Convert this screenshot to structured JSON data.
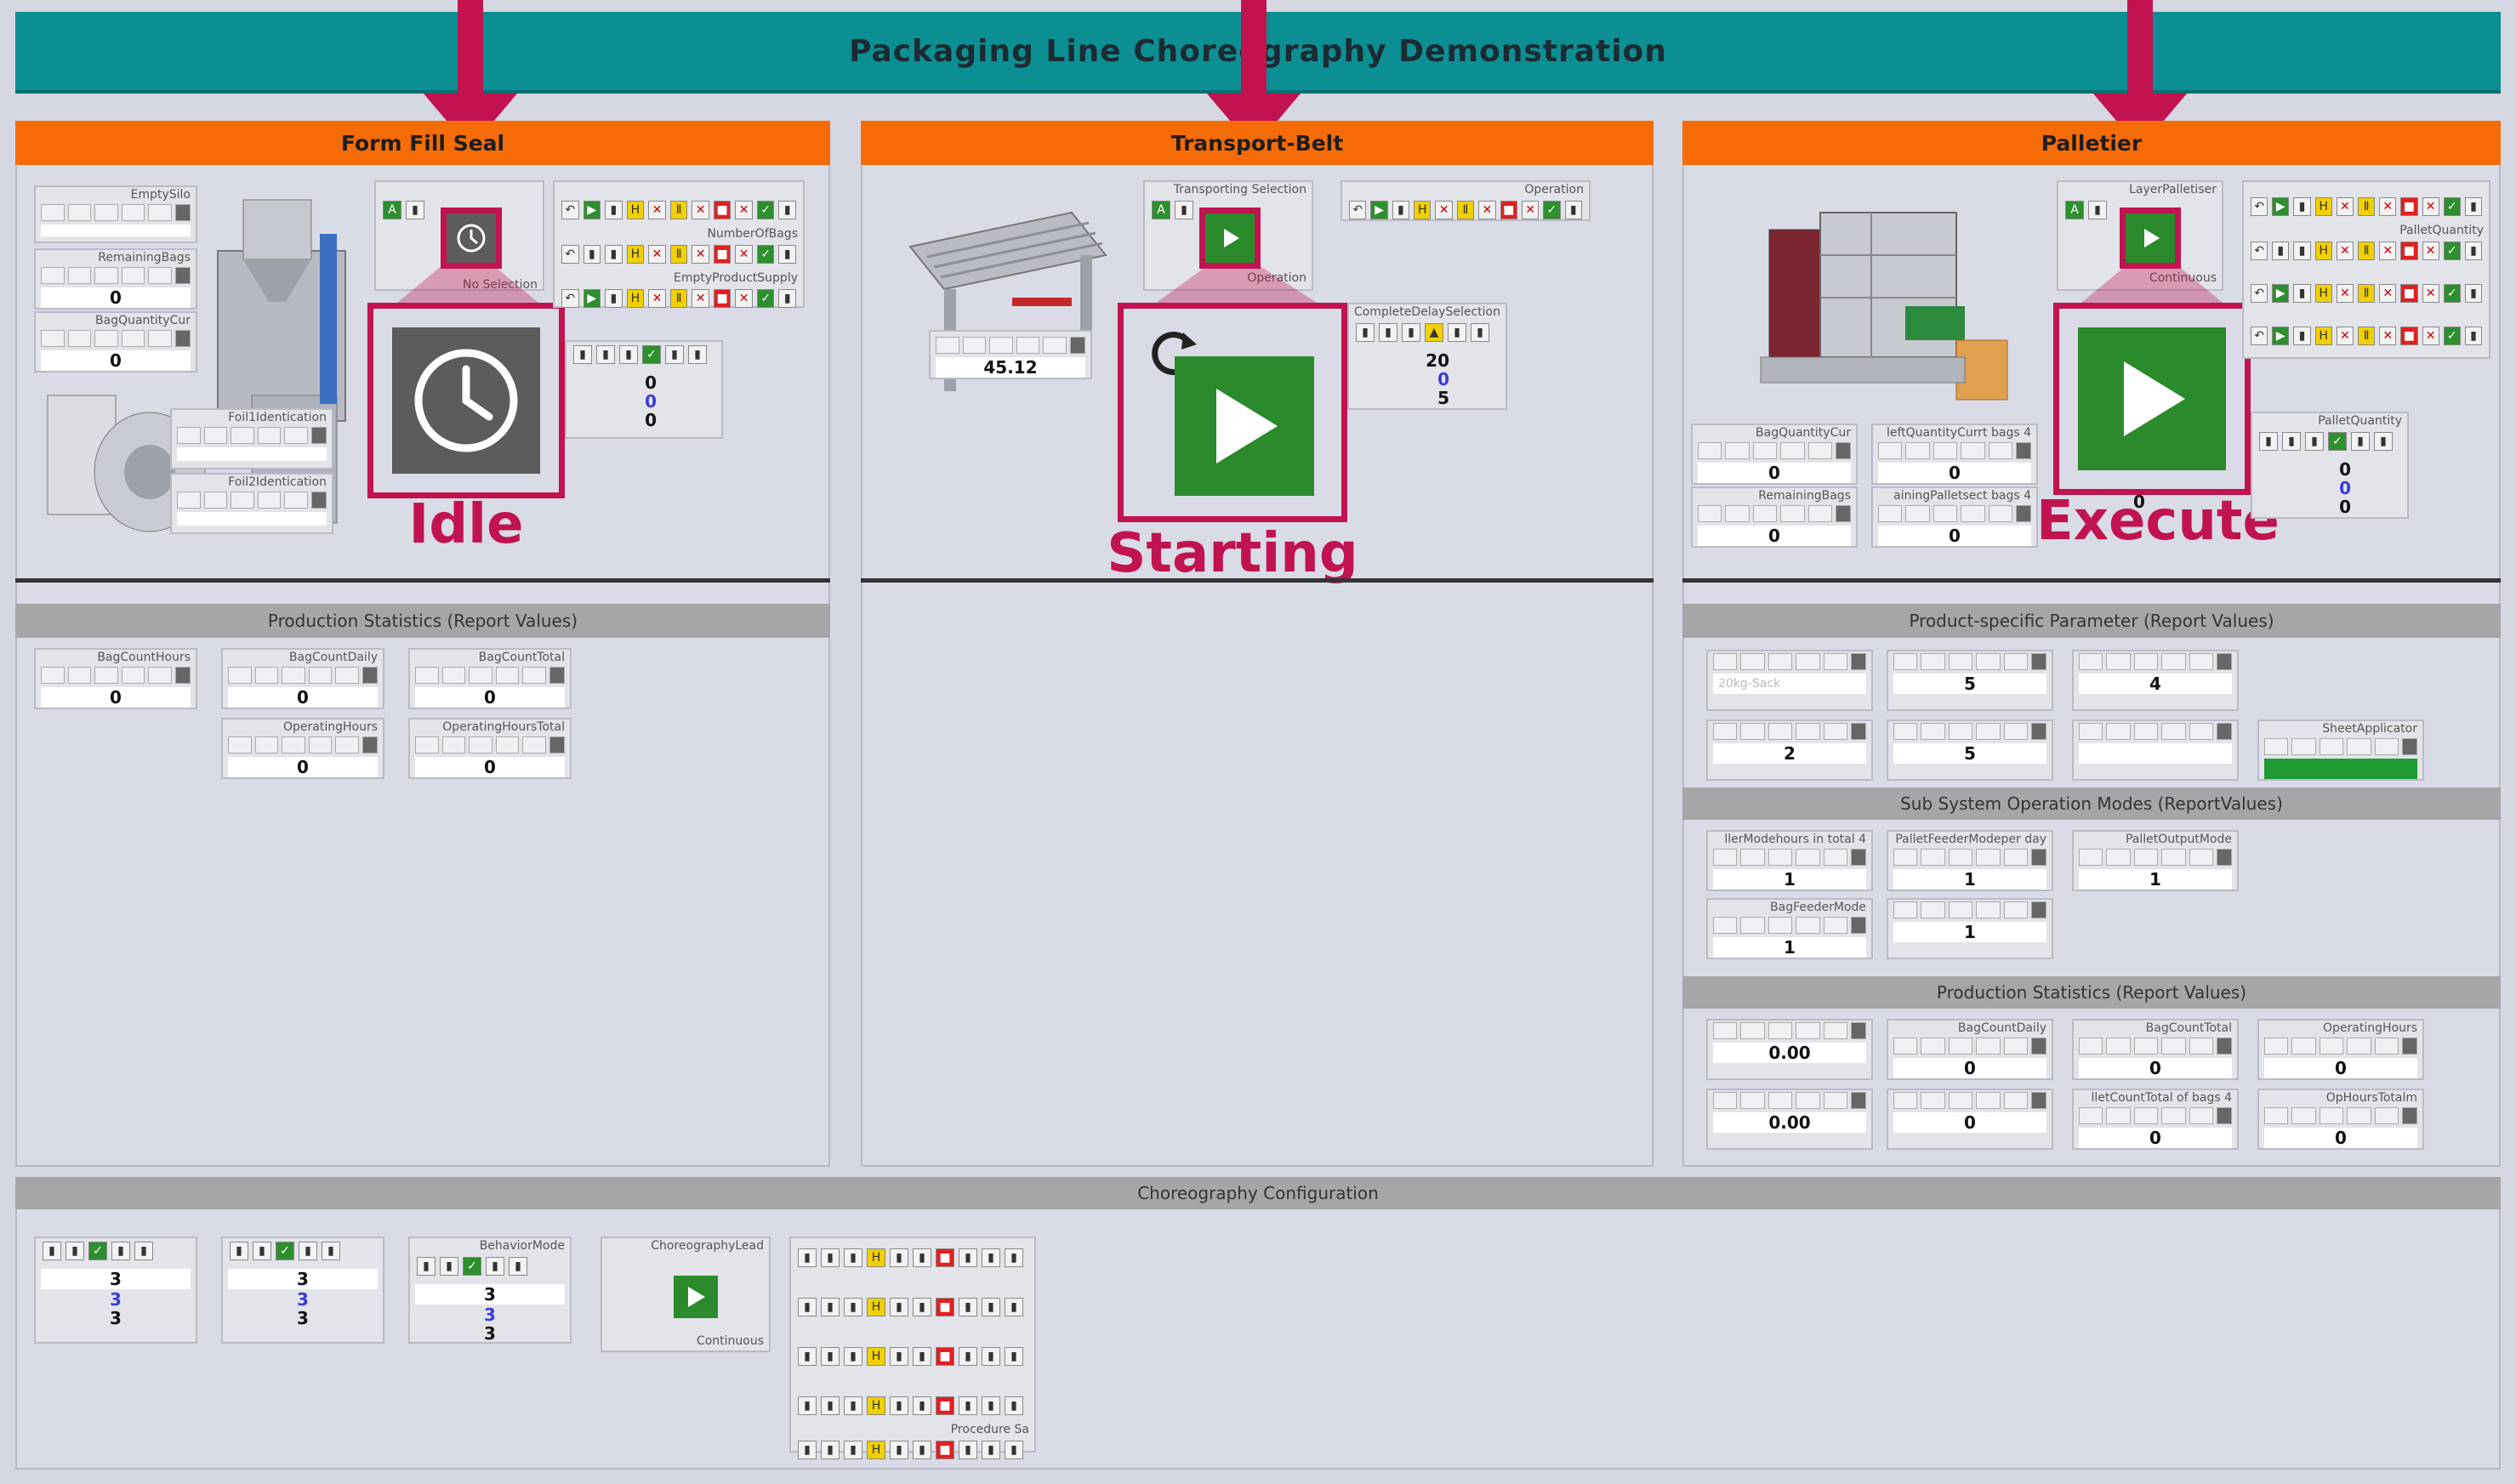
{
  "title": "Packaging Line Choreography Demonstration",
  "panels": {
    "ffs": {
      "header": "Form Fill Seal",
      "widgets": {
        "empty_silo": "EmptySilo",
        "remaining_bags": "RemainingBags",
        "remaining_bags_val": "0",
        "bag_quantity_cur": "BagQuantityCur",
        "bag_quantity_cur_val": "0",
        "foil1": "Foil1Identication",
        "foil2": "Foil2Identication",
        "number_of_bags": "NumberOfBags",
        "empty_product_supply": "EmptyProductSupply",
        "no_selection": "No Selection",
        "v1": "0",
        "v2": "0",
        "v3": "0"
      },
      "state_label": "Idle"
    },
    "belt": {
      "header": "Transport-Belt",
      "transporting_selection": "Transporting Selection",
      "operation": "Operation",
      "operation2": "Operation",
      "complete_delay_selection": "CompleteDelaySelection",
      "belt_value": "45.12",
      "v1": "20",
      "v2": "0",
      "v3": "5",
      "state_label": "Starting"
    },
    "pall": {
      "header": "Palletier",
      "layer_palletiser": "LayerPalletiser",
      "pallet_quantity": "PalletQuantity",
      "continuous": "Continuous",
      "bag_quantity_cur": "BagQuantityCur",
      "bag_quantity_cur_val": "0",
      "left_quantity": "leftQuantityCurrt bags 4",
      "left_quantity_val": "0",
      "remaining_bags": "RemainingBags",
      "remaining_bags_val": "0",
      "remaining_pallet": "ainingPalletsect bags 4",
      "remaining_pallet_val": "0",
      "pallet_quantity2": "PalletQuantity",
      "pq_v1": "0",
      "pq_v2": "0",
      "pq_v3": "0",
      "zero_mid": "0",
      "state_label": "Execute"
    }
  },
  "prod_stats_left": {
    "header": "Production Statistics (Report Values)",
    "items": [
      {
        "label": "BagCountHours",
        "value": "0"
      },
      {
        "label": "BagCountDaily",
        "value": "0"
      },
      {
        "label": "BagCountTotal",
        "value": "0"
      },
      {
        "label": "OperatingHours",
        "value": "0"
      },
      {
        "label": "OperatingHoursTotal",
        "value": "0"
      }
    ]
  },
  "product_params": {
    "header": "Product-specific Parameter (Report Values)",
    "items": [
      {
        "label": "",
        "value": "20kg-Sack"
      },
      {
        "label": "",
        "value": "5"
      },
      {
        "label": "",
        "value": "4"
      },
      {
        "label": "",
        "value": "2"
      },
      {
        "label": "",
        "value": "5"
      },
      {
        "label": "",
        "value": ""
      },
      {
        "label": "SheetApplicator",
        "value": ""
      }
    ]
  },
  "subsystem": {
    "header": "Sub System Operation Modes (ReportValues)",
    "items": [
      {
        "label": "llerModehours in total 4",
        "value": "1"
      },
      {
        "label": "PalletFeederModeper day",
        "value": "1"
      },
      {
        "label": "PalletOutputMode",
        "value": "1"
      },
      {
        "label": "BagFeederMode",
        "value": "1"
      },
      {
        "label": "",
        "value": "1"
      }
    ]
  },
  "prod_stats_right": {
    "header": "Production Statistics (Report Values)",
    "items": [
      {
        "label": "",
        "value": "0.00"
      },
      {
        "label": "BagCountDaily",
        "value": "0"
      },
      {
        "label": "BagCountTotal",
        "value": "0"
      },
      {
        "label": "OperatingHours",
        "value": "0"
      },
      {
        "label": "",
        "value": "0.00"
      },
      {
        "label": "",
        "value": "0"
      },
      {
        "label": "lletCountTotal of bags 4",
        "value": "0"
      },
      {
        "label": "OpHoursTotalm",
        "value": "0"
      }
    ]
  },
  "choreo": {
    "header": "Choreography Configuration",
    "groups": [
      {
        "label": "",
        "v1": "3",
        "v2": "3",
        "v3": "3"
      },
      {
        "label": "",
        "v1": "3",
        "v2": "3",
        "v3": "3"
      },
      {
        "label": "BehaviorMode",
        "v1": "3",
        "v2": "3",
        "v3": "3"
      }
    ],
    "lead_label": "ChoreographyLead",
    "lead_continuous": "Continuous",
    "procedure_label": "Procedure Sa"
  },
  "colors": {
    "title": "#0c8f92",
    "panel_header": "#f56c06",
    "highlight": "#c0134f",
    "run_green": "#2b8a2b"
  }
}
